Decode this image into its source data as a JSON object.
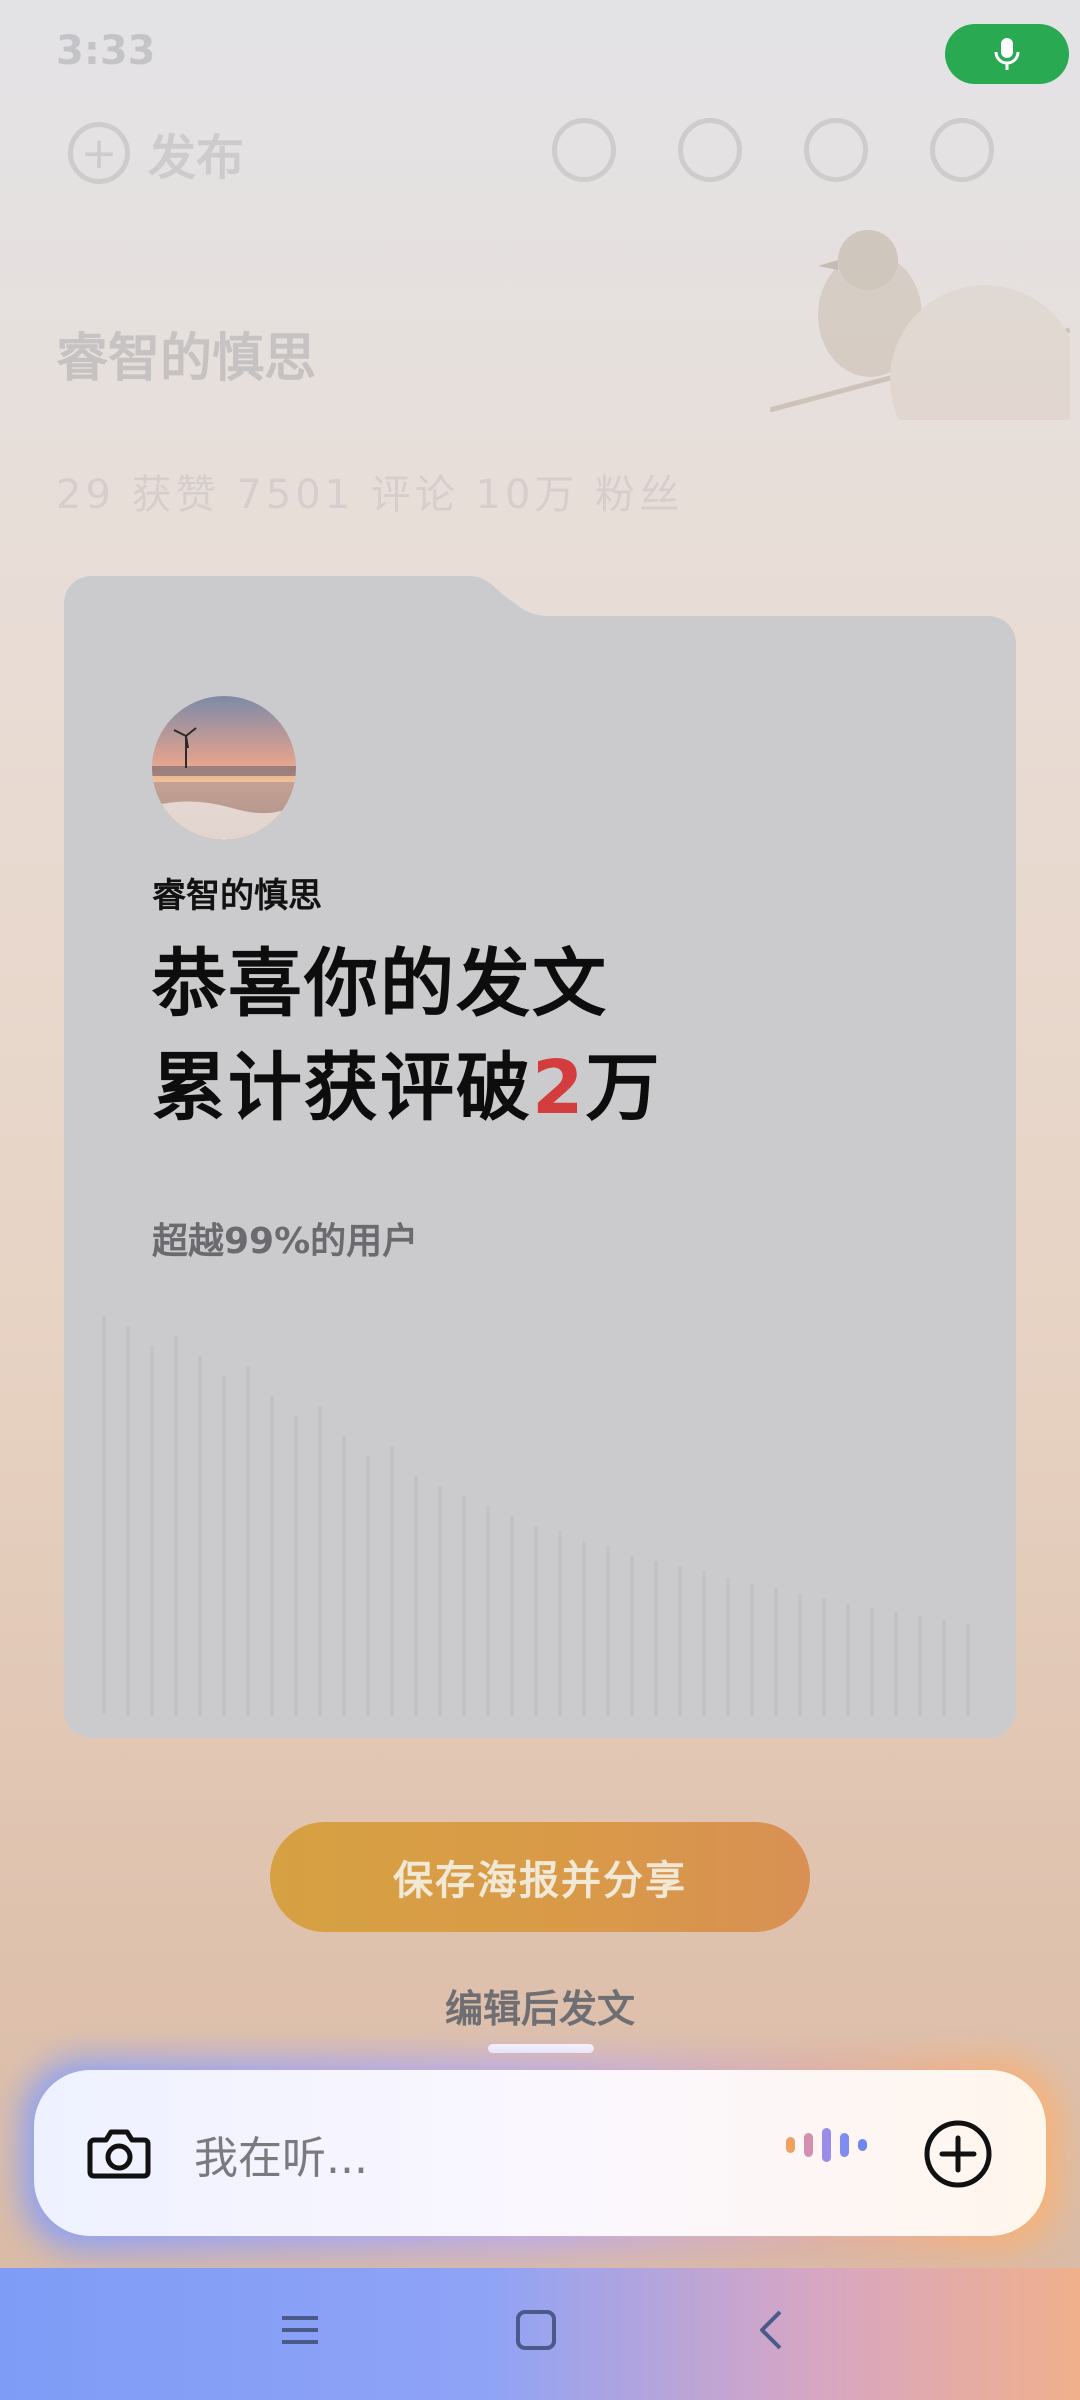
{
  "status": {
    "time": "3:33"
  },
  "background_page": {
    "publish_label": "发布",
    "profile_name": "睿智的慎思",
    "stats_text": "29 获赞 7501 评论 10万 粉丝"
  },
  "card": {
    "username": "睿智的慎思",
    "headline_line1": "恭喜你的发文",
    "headline_line2_prefix": "累计获评破",
    "headline_number": "2",
    "headline_line2_suffix": "万",
    "subtitle": "超越99%的用户"
  },
  "actions": {
    "save_share_label": "保存海报并分享",
    "edit_post_label": "编辑后发文"
  },
  "assistant": {
    "placeholder": "我在听..."
  },
  "icons": {
    "mic": "microphone-icon",
    "camera": "camera-icon",
    "add": "plus-circle-icon",
    "nav": [
      "menu-icon",
      "home-square-icon",
      "back-chevron-icon"
    ]
  },
  "colors": {
    "accent_red": "#d43d3d",
    "save_button": "#d89a48",
    "mic_green": "#2aa953"
  }
}
